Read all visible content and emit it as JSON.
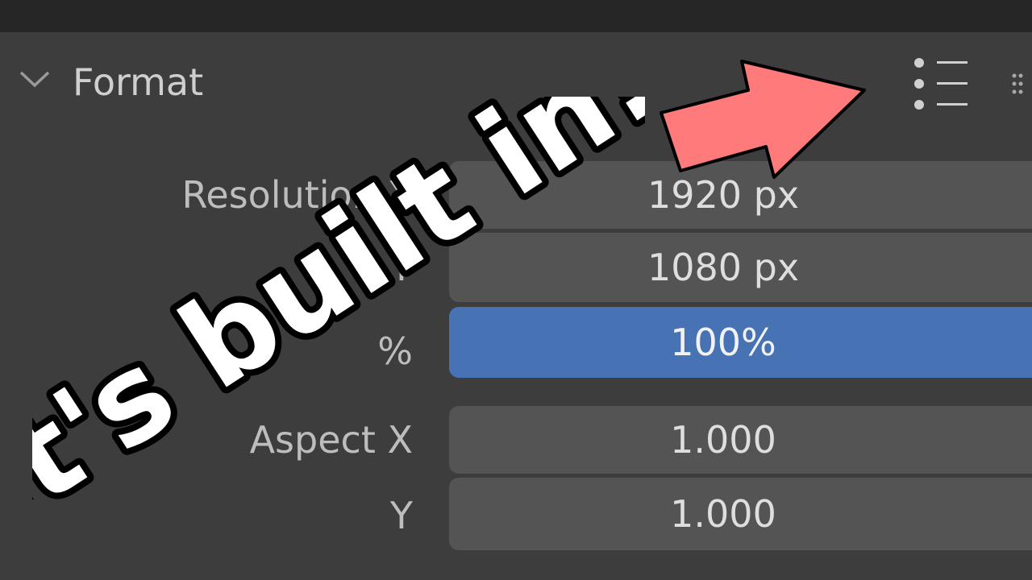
{
  "panel": {
    "title": "Format"
  },
  "fields": [
    {
      "label": "Resolution X",
      "value": "1920 px"
    },
    {
      "label": "Y",
      "value": "1080 px"
    },
    {
      "label": "%",
      "value": "100%"
    },
    {
      "label": "Aspect X",
      "value": "1.000"
    },
    {
      "label": "Y",
      "value": "1.000"
    }
  ],
  "overlay": {
    "caption": "it's built in!",
    "arrow_color": "#ff7b7b"
  },
  "colors": {
    "active_field": "#4772b3",
    "field": "#545454",
    "panel_bg": "#3d3d3d"
  },
  "icons": {
    "collapse": "chevron-down-icon",
    "presets": "presets-list-icon",
    "drag": "drag-handle-icon"
  }
}
